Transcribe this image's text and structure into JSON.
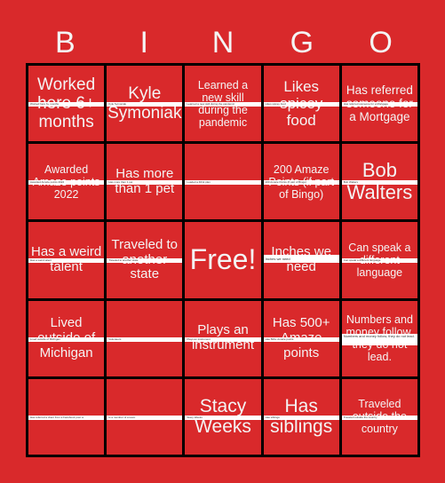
{
  "header": {
    "letters": [
      "B",
      "I",
      "N",
      "G",
      "O"
    ]
  },
  "colors": {
    "background": "#d9292b",
    "grid_lines": "#000000",
    "text": "#f4f4f4",
    "strip": "#ffffff"
  },
  "cells": [
    {
      "label": "Worked here 6+ months",
      "strip": "Worked here 6+ months"
    },
    {
      "label": "Kyle Symoniak",
      "strip": "Kyle Symoniak"
    },
    {
      "label": "Learned a new skill during the pandemic",
      "strip": "Learned a new skill during the pandemic"
    },
    {
      "label": "Likes spicey food",
      "strip": "Likes spicey food"
    },
    {
      "label": "Has referred someone for a Mortgage",
      "strip": "Has referred someone for a Mortgage"
    },
    {
      "label": "Awarded Amaze points 2022",
      "strip": "Awarded Amaze points 2022"
    },
    {
      "label": "Has more than 1 pet",
      "strip": "Has more than 1 pet"
    },
    {
      "label": "",
      "strip": "Loaded a 401k plan"
    },
    {
      "label": "200 Amaze Points (if part of Bingo)",
      "strip": "200 Amaze Points (if part of Bingo)"
    },
    {
      "label": "Bob Walters",
      "strip": "Bob Walters"
    },
    {
      "label": "Has a weird talent",
      "strip": "Has a weird talent"
    },
    {
      "label": "Traveled to another state",
      "strip": "Traveled to another state"
    },
    {
      "label": "Free!",
      "strip": ""
    },
    {
      "label": "Inches we need",
      "strip": "Inches we need"
    },
    {
      "label": "Can speak a different language",
      "strip": "Can speak a different language"
    },
    {
      "label": "Lived outside of Michigan",
      "strip": "Lived outside of Michigan"
    },
    {
      "label": "",
      "strip": "Volunteers"
    },
    {
      "label": "Plays an instrument",
      "strip": "Plays an instrument"
    },
    {
      "label": "Has 500+ Amaze points",
      "strip": "Has 500+ Amaze points"
    },
    {
      "label": "Numbers and money follow, they do not lead.",
      "strip": "Numbers and money follow, they do not lead."
    },
    {
      "label": "",
      "strip": "Has referred a client from a Facebook post or"
    },
    {
      "label": "",
      "strip": "Is a member of a team"
    },
    {
      "label": "Stacy Weeks",
      "strip": "Stacy Weeks"
    },
    {
      "label": "Has siblings",
      "strip": "Has siblings"
    },
    {
      "label": "Traveled outside the country",
      "strip": "Traveled outside the country"
    }
  ]
}
